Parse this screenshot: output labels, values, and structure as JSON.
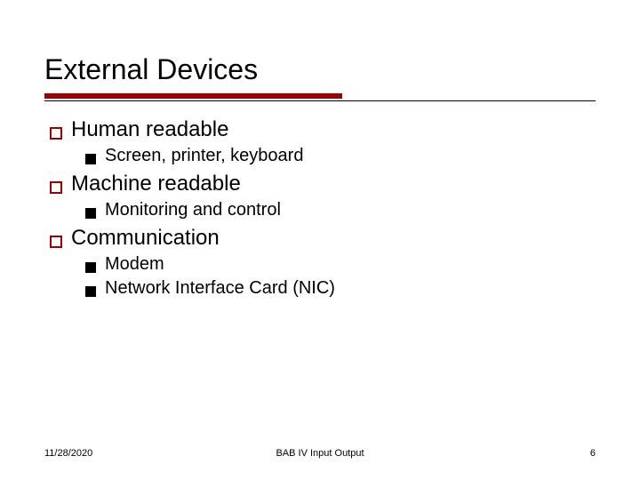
{
  "title": "External Devices",
  "items": [
    {
      "label": "Human readable",
      "sub": [
        "Screen, printer, keyboard"
      ]
    },
    {
      "label": "Machine readable",
      "sub": [
        "Monitoring and control"
      ]
    },
    {
      "label": "Communication",
      "sub": [
        "Modem",
        "Network Interface Card (NIC)"
      ]
    }
  ],
  "footer": {
    "date": "11/28/2020",
    "center": "BAB IV   Input Output",
    "page": "6"
  }
}
